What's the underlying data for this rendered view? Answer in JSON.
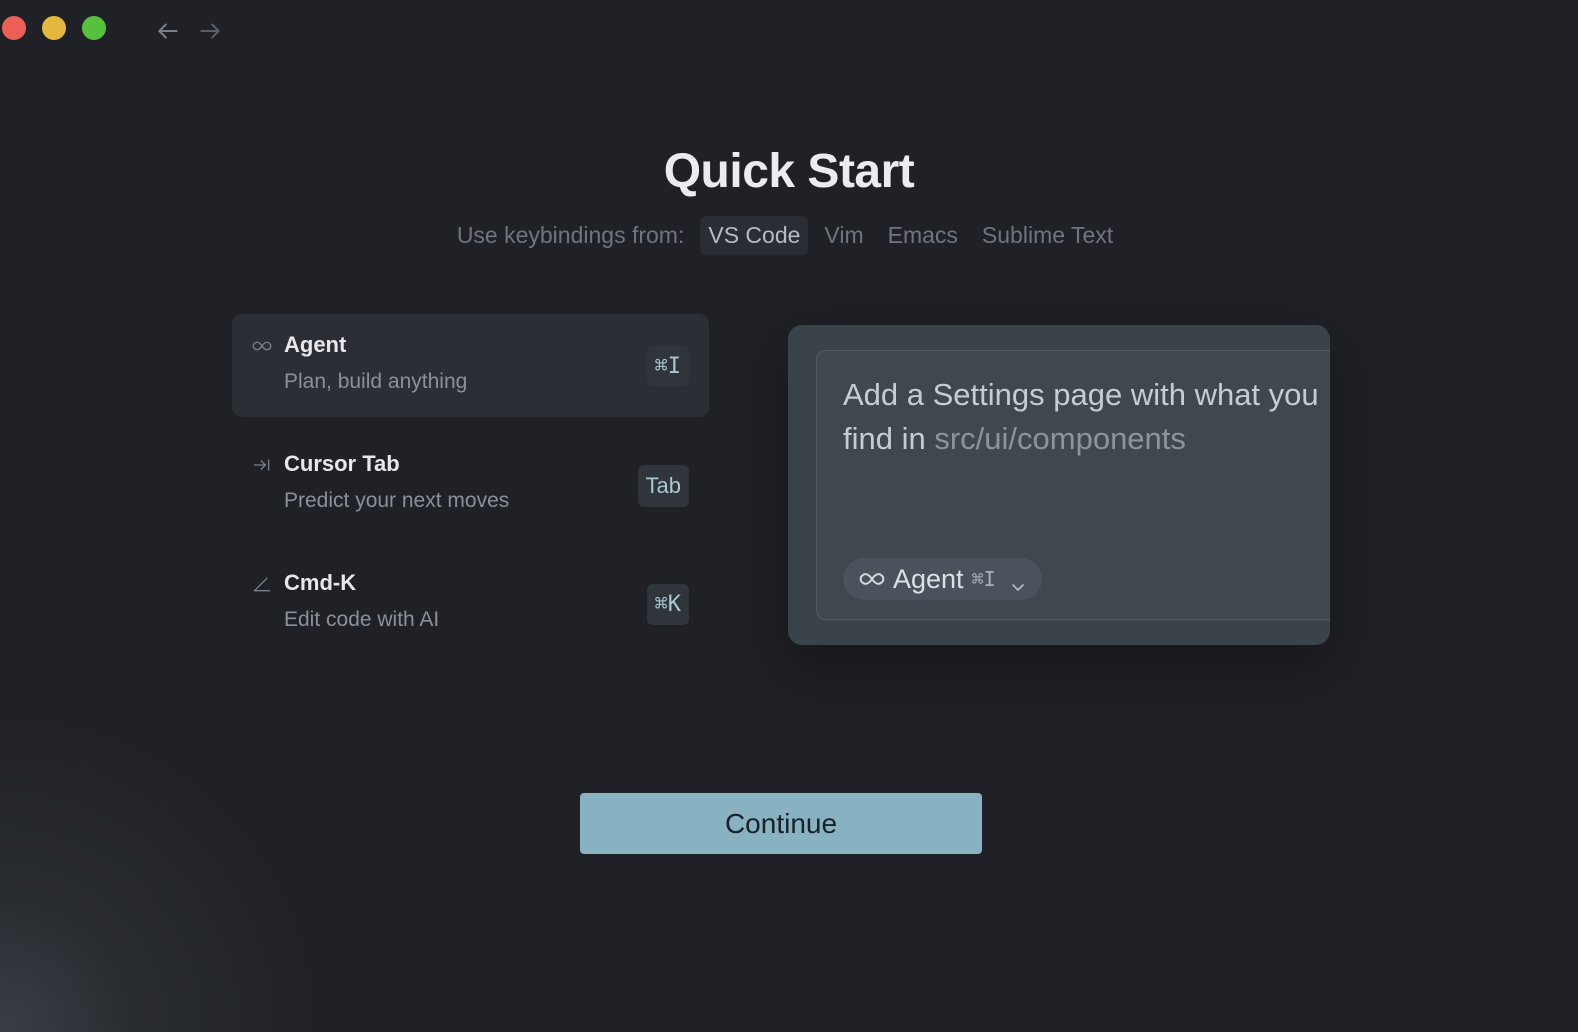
{
  "window": {
    "nav": {
      "back_icon": "arrow-left-icon",
      "forward_icon": "arrow-right-icon"
    }
  },
  "header": {
    "title": "Quick Start",
    "keybindings_label": "Use keybindings from:",
    "keybinding_options": [
      {
        "label": "VS Code",
        "selected": true
      },
      {
        "label": "Vim",
        "selected": false
      },
      {
        "label": "Emacs",
        "selected": false
      },
      {
        "label": "Sublime Text",
        "selected": false
      }
    ]
  },
  "features": [
    {
      "icon": "infinity-icon",
      "title": "Agent",
      "subtitle": "Plan, build anything",
      "shortcut": "⌘I",
      "active": true
    },
    {
      "icon": "tab-arrow-icon",
      "title": "Cursor Tab",
      "subtitle": "Predict your next moves",
      "shortcut": "Tab",
      "active": false
    },
    {
      "icon": "edit-angle-icon",
      "title": "Cmd-K",
      "subtitle": "Edit code with AI",
      "shortcut": "⌘K",
      "active": false
    }
  ],
  "preview": {
    "prompt_text": "Add a Settings page with what you find in ",
    "prompt_path": "src/ui/components",
    "mode_chip": {
      "icon": "infinity-icon",
      "label": "Agent",
      "shortcut": "⌘I",
      "dropdown_icon": "chevron-down-icon"
    }
  },
  "actions": {
    "continue_label": "Continue"
  },
  "colors": {
    "background": "#1f2126",
    "continue_button": "#88b1c1",
    "shortcut_text": "#a9c6d1"
  }
}
